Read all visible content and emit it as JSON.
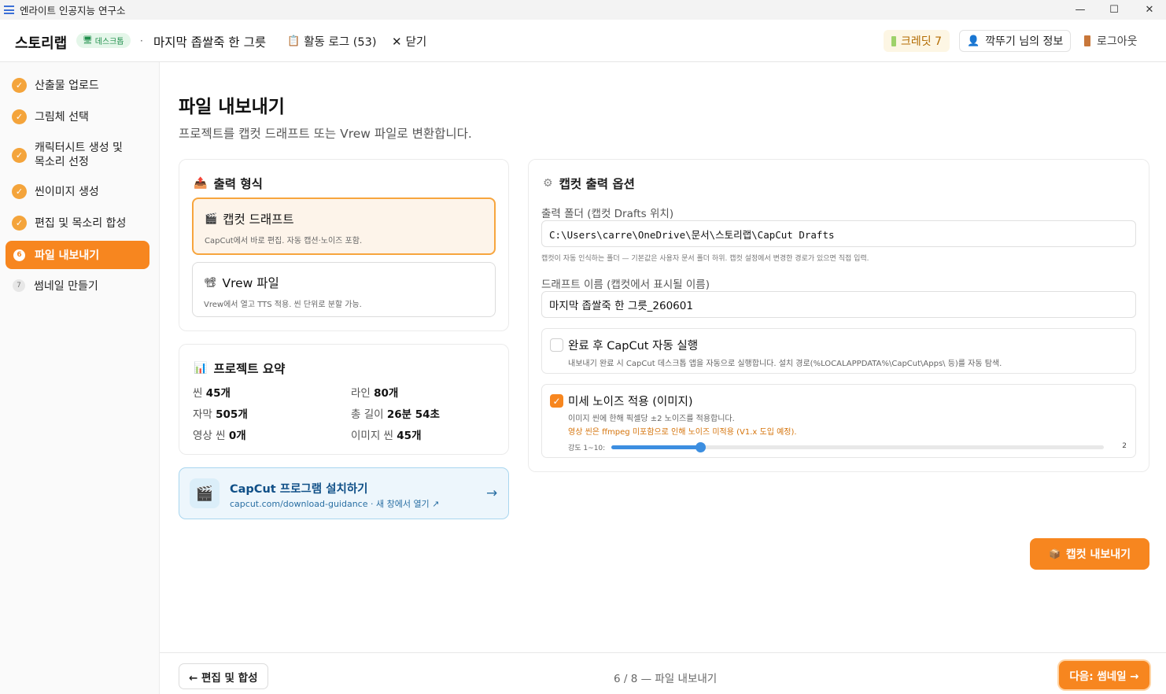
{
  "window": {
    "title": "엔라이트 인공지능 연구소",
    "minimize": "—",
    "maximize": "☐",
    "close": "✕"
  },
  "header": {
    "brand": "스토리랩",
    "badge": "데스크톱",
    "separator": "·",
    "project_name": "마지막 좁쌀죽 한 그릇",
    "activity_log": "활동 로그 (53)",
    "close_label": "닫기",
    "credit": "크레딧 7",
    "user": "깍뚜기 님의 정보",
    "logout": "로그아웃"
  },
  "sidebar": {
    "items": [
      {
        "num": "✓",
        "label": "산출물 업로드",
        "state": "done"
      },
      {
        "num": "✓",
        "label": "그림체 선택",
        "state": "done"
      },
      {
        "num": "✓",
        "label": "캐릭터시트 생성 및 목소리 선정",
        "state": "done"
      },
      {
        "num": "✓",
        "label": "씬이미지 생성",
        "state": "done"
      },
      {
        "num": "✓",
        "label": "편집 및 목소리 합성",
        "state": "done"
      },
      {
        "num": "6",
        "label": "파일 내보내기",
        "state": "active"
      },
      {
        "num": "7",
        "label": "썸네일 만들기",
        "state": "todo"
      }
    ]
  },
  "page": {
    "title": "파일 내보내기",
    "subtitle": "프로젝트를 캡컷 드래프트 또는 Vrew 파일로 변환합니다."
  },
  "output_format": {
    "title": "출력 형식",
    "options": [
      {
        "title": "캡컷 드래프트",
        "desc": "CapCut에서 바로 편집. 자동 캡션·노이즈 포함.",
        "selected": true
      },
      {
        "title": "Vrew 파일",
        "desc": "Vrew에서 열고 TTS 적용. 씬 단위로 분할 가능.",
        "selected": false
      }
    ]
  },
  "summary": {
    "title": "프로젝트 요약",
    "rows": [
      {
        "label": "씬",
        "value": "45개"
      },
      {
        "label": "라인",
        "value": "80개"
      },
      {
        "label": "자막",
        "value": "505개"
      },
      {
        "label": "총 길이",
        "value": "26분 54초"
      },
      {
        "label": "영상 씬",
        "value": "0개"
      },
      {
        "label": "이미지 씬",
        "value": "45개"
      }
    ]
  },
  "install": {
    "title": "CapCut 프로그램 설치하기",
    "subtitle": "capcut.com/download-guidance · 새 창에서 열기 ↗",
    "arrow": "→"
  },
  "capcut_options": {
    "title": "캡컷 출력 옵션",
    "folder_label": "출력 폴더 (캡컷 Drafts 위치)",
    "folder_value": "C:\\Users\\carre\\OneDrive\\문서\\스토리랩\\CapCut Drafts",
    "folder_hint": "캡컷이 자동 인식하는 폴더 — 기본값은 사용자 문서 폴더 하위. 캡컷 설정에서 변경한 경로가 있으면 직접 입력.",
    "draft_label": "드래프트 이름 (캡컷에서 표시될 이름)",
    "draft_value": "마지막 좁쌀죽 한 그릇_260601",
    "autorun": {
      "title": "완료 후 CapCut 자동 실행",
      "desc": "내보내기 완료 시 CapCut 데스크톱 앱을 자동으로 실행합니다. 설치 경로(%LOCALAPPDATA%\\CapCut\\Apps\\ 등)를 자동 탐색.",
      "checked": false
    },
    "noise": {
      "title": "미세 노이즈 적용 (이미지)",
      "desc": "이미지 씬에 한해 픽셀당 ±2 노이즈를 적용합니다.",
      "warning": "영상 씬은 ffmpeg 미포함으로 인해 노이즈 미적용 (V1.x 도입 예정).",
      "checked": true,
      "strength_label": "강도 1~10:",
      "strength_value": "2",
      "strength": 2,
      "strength_min": 1,
      "strength_max": 10
    }
  },
  "export_button": "캡컷 내보내기",
  "footer": {
    "back": "← 편집 및 합성",
    "pager": "6 / 8 — 파일 내보내기",
    "next": "다음: 썸네일 →"
  }
}
